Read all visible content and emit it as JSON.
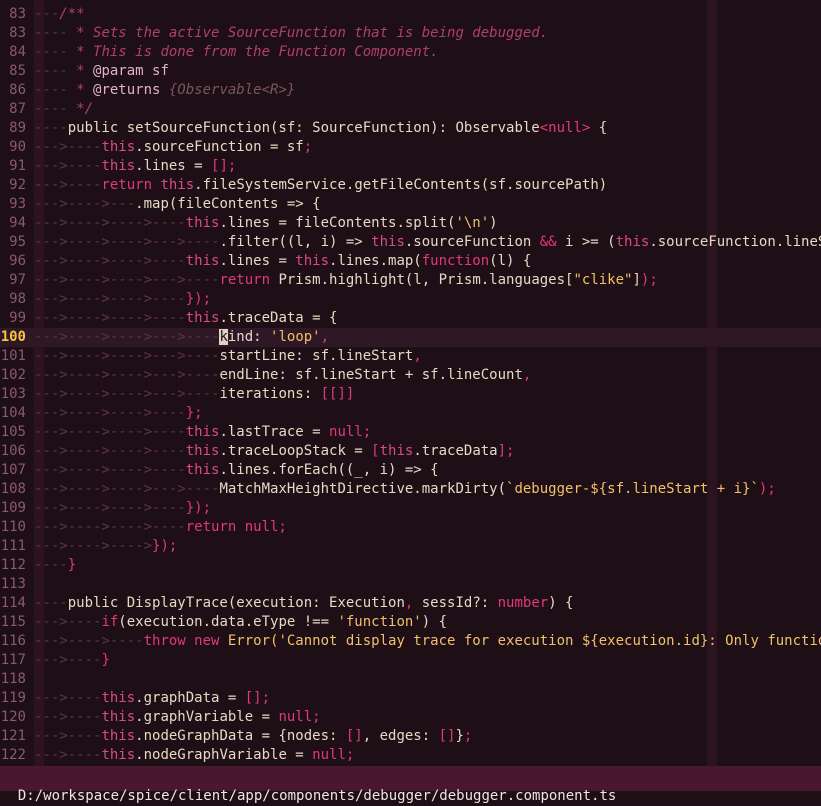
{
  "status_path": "D:/workspace/spice/client/app/components/debugger/debugger.component.ts",
  "colors": {
    "background": "#1e0e16",
    "keyword": "#e0397e",
    "string": "#f2c069",
    "comment": "#b04068",
    "status_bar": "#4a1730",
    "current_line_number": "#f5c542"
  },
  "current_line": 100,
  "lines": [
    {
      "n": "83",
      "parts": [
        [
          "ind",
          "---"
        ],
        [
          "cm",
          "/**"
        ]
      ]
    },
    {
      "n": "83",
      "parts": [
        [
          "ind",
          "---- "
        ],
        [
          "cm",
          "* Sets the active SourceFunction that is being debugged."
        ]
      ]
    },
    {
      "n": "84",
      "parts": [
        [
          "ind",
          "---- "
        ],
        [
          "cm",
          "* This is done from the Function Component."
        ]
      ]
    },
    {
      "n": "85",
      "parts": [
        [
          "ind",
          "---- "
        ],
        [
          "cm",
          "* "
        ],
        [
          "cmtag",
          "@param sf"
        ]
      ]
    },
    {
      "n": "86",
      "parts": [
        [
          "ind",
          "---- "
        ],
        [
          "cm",
          "* "
        ],
        [
          "cmtag",
          "@returns "
        ],
        [
          "cmtype",
          "{Observable<R>}"
        ]
      ]
    },
    {
      "n": "87",
      "parts": [
        [
          "ind",
          "---- "
        ],
        [
          "cm",
          "*/"
        ]
      ]
    },
    {
      "n": "89",
      "parts": [
        [
          "ind",
          "----"
        ],
        [
          "code",
          "public setSourceFunction(sf: SourceFunction): Observable"
        ],
        [
          "kw",
          "<null>"
        ],
        [
          "code",
          " {"
        ]
      ]
    },
    {
      "n": "90",
      "parts": [
        [
          "ind",
          "--->----"
        ],
        [
          "th",
          "this"
        ],
        [
          "code",
          ".sourceFunction = sf"
        ],
        [
          "kw",
          ";"
        ]
      ]
    },
    {
      "n": "91",
      "parts": [
        [
          "ind",
          "--->----"
        ],
        [
          "th",
          "this"
        ],
        [
          "code",
          ".lines = "
        ],
        [
          "kw",
          "[];"
        ]
      ]
    },
    {
      "n": "92",
      "parts": [
        [
          "ind",
          "--->----"
        ],
        [
          "kw",
          "return "
        ],
        [
          "th",
          "this"
        ],
        [
          "code",
          ".fileSystemService.getFileContents(sf.sourcePath)"
        ]
      ]
    },
    {
      "n": "93",
      "parts": [
        [
          "ind",
          "--->---->---"
        ],
        [
          "code",
          ".map(fileContents => {"
        ]
      ]
    },
    {
      "n": "94",
      "parts": [
        [
          "ind",
          "--->---->---->----"
        ],
        [
          "th",
          "this"
        ],
        [
          "code",
          ".lines = fileContents.split("
        ],
        [
          "str",
          "'\\n'"
        ],
        [
          "code",
          ")"
        ]
      ]
    },
    {
      "n": "95",
      "parts": [
        [
          "ind",
          "--->---->---->--->----"
        ],
        [
          "code",
          ".filter((l, i) => "
        ],
        [
          "th",
          "this"
        ],
        [
          "code",
          ".sourceFunction "
        ],
        [
          "kw",
          "&&"
        ],
        [
          "code",
          " i >= ("
        ],
        [
          "th",
          "this"
        ],
        [
          "code",
          ".sourceFunction.lineSta"
        ]
      ]
    },
    {
      "n": "96",
      "parts": [
        [
          "ind",
          "--->---->---->----"
        ],
        [
          "th",
          "this"
        ],
        [
          "code",
          ".lines = "
        ],
        [
          "th",
          "this"
        ],
        [
          "code",
          ".lines.map("
        ],
        [
          "kw",
          "function"
        ],
        [
          "code",
          "(l) {"
        ]
      ]
    },
    {
      "n": "97",
      "parts": [
        [
          "ind",
          "--->---->---->--->----"
        ],
        [
          "kw",
          "return "
        ],
        [
          "code",
          "Prism.highlight(l, Prism.languages["
        ],
        [
          "str",
          "\"clike\""
        ],
        [
          "code",
          "]"
        ],
        [
          "kw",
          ");"
        ]
      ]
    },
    {
      "n": "98",
      "parts": [
        [
          "ind",
          "--->---->---->----"
        ],
        [
          "kw",
          "});"
        ]
      ]
    },
    {
      "n": "99",
      "parts": [
        [
          "ind",
          "--->---->---->----"
        ],
        [
          "th",
          "this"
        ],
        [
          "code",
          ".traceData = {"
        ]
      ]
    },
    {
      "n": "100",
      "parts": [
        [
          "ind",
          "--->---->---->--->----"
        ],
        [
          "cursor",
          "k"
        ],
        [
          "code",
          "ind: "
        ],
        [
          "str",
          "'loop'"
        ],
        [
          "kw",
          ","
        ]
      ]
    },
    {
      "n": "101",
      "parts": [
        [
          "ind",
          "--->---->---->--->----"
        ],
        [
          "code",
          "startLine: sf.lineStart"
        ],
        [
          "kw",
          ","
        ]
      ]
    },
    {
      "n": "102",
      "parts": [
        [
          "ind",
          "--->---->---->--->----"
        ],
        [
          "code",
          "endLine: sf.lineStart + sf.lineCount"
        ],
        [
          "kw",
          ","
        ]
      ]
    },
    {
      "n": "103",
      "parts": [
        [
          "ind",
          "--->---->---->--->----"
        ],
        [
          "code",
          "iterations: "
        ],
        [
          "kw",
          "[[]]"
        ]
      ]
    },
    {
      "n": "104",
      "parts": [
        [
          "ind",
          "--->---->---->----"
        ],
        [
          "kw",
          "};"
        ]
      ]
    },
    {
      "n": "105",
      "parts": [
        [
          "ind",
          "--->---->---->----"
        ],
        [
          "th",
          "this"
        ],
        [
          "code",
          ".lastTrace = "
        ],
        [
          "kw",
          "null;"
        ]
      ]
    },
    {
      "n": "106",
      "parts": [
        [
          "ind",
          "--->---->---->----"
        ],
        [
          "th",
          "this"
        ],
        [
          "code",
          ".traceLoopStack = "
        ],
        [
          "kw",
          "["
        ],
        [
          "th",
          "this"
        ],
        [
          "code",
          ".traceData"
        ],
        [
          "kw",
          "];"
        ]
      ]
    },
    {
      "n": "107",
      "parts": [
        [
          "ind",
          "--->---->---->----"
        ],
        [
          "th",
          "this"
        ],
        [
          "code",
          ".lines.forEach((_, i) => {"
        ]
      ]
    },
    {
      "n": "108",
      "parts": [
        [
          "ind",
          "--->---->---->--->----"
        ],
        [
          "code",
          "MatchMaxHeightDirective.markDirty("
        ],
        [
          "str",
          "`debugger-${sf.lineStart + i}`"
        ],
        [
          "kw",
          ");"
        ]
      ]
    },
    {
      "n": "109",
      "parts": [
        [
          "ind",
          "--->---->---->----"
        ],
        [
          "kw",
          "});"
        ]
      ]
    },
    {
      "n": "110",
      "parts": [
        [
          "ind",
          "--->---->---->----"
        ],
        [
          "kw",
          "return null;"
        ]
      ]
    },
    {
      "n": "111",
      "parts": [
        [
          "ind",
          "--->---->---->"
        ],
        [
          "kw",
          "});"
        ]
      ]
    },
    {
      "n": "112",
      "parts": [
        [
          "ind",
          "----"
        ],
        [
          "kw",
          "}"
        ]
      ]
    },
    {
      "n": "113",
      "parts": []
    },
    {
      "n": "114",
      "parts": [
        [
          "ind",
          "----"
        ],
        [
          "code",
          "public DisplayTrace(execution: Execution"
        ],
        [
          "kw",
          ","
        ],
        [
          "code",
          " sessId?: "
        ],
        [
          "kw",
          "number"
        ],
        [
          "code",
          ") {"
        ]
      ]
    },
    {
      "n": "115",
      "parts": [
        [
          "ind",
          "--->----"
        ],
        [
          "kw",
          "if"
        ],
        [
          "code",
          "(execution.data.eType !== "
        ],
        [
          "str",
          "'function'"
        ],
        [
          "code",
          ") {"
        ]
      ]
    },
    {
      "n": "116",
      "parts": [
        [
          "ind",
          "--->---->----"
        ],
        [
          "kw",
          "throw new "
        ],
        [
          "str",
          "Error('Cannot display trace for execution ${execution.id}: Only function"
        ]
      ]
    },
    {
      "n": "117",
      "parts": [
        [
          "ind",
          "--->----"
        ],
        [
          "kw",
          "}"
        ]
      ]
    },
    {
      "n": "118",
      "parts": []
    },
    {
      "n": "119",
      "parts": [
        [
          "ind",
          "--->----"
        ],
        [
          "th",
          "this"
        ],
        [
          "code",
          ".graphData = "
        ],
        [
          "kw",
          "[];"
        ]
      ]
    },
    {
      "n": "120",
      "parts": [
        [
          "ind",
          "--->----"
        ],
        [
          "th",
          "this"
        ],
        [
          "code",
          ".graphVariable = "
        ],
        [
          "kw",
          "null;"
        ]
      ]
    },
    {
      "n": "121",
      "parts": [
        [
          "ind",
          "--->----"
        ],
        [
          "th",
          "this"
        ],
        [
          "code",
          ".nodeGraphData = {nodes: "
        ],
        [
          "kw",
          "[]"
        ],
        [
          "code",
          ", edges: "
        ],
        [
          "kw",
          "[]"
        ],
        [
          "code",
          "}"
        ],
        [
          "kw",
          ";"
        ]
      ]
    },
    {
      "n": "122",
      "parts": [
        [
          "ind",
          "--->----"
        ],
        [
          "th",
          "this"
        ],
        [
          "code",
          ".nodeGraphVariable = "
        ],
        [
          "kw",
          "null;"
        ]
      ]
    }
  ]
}
